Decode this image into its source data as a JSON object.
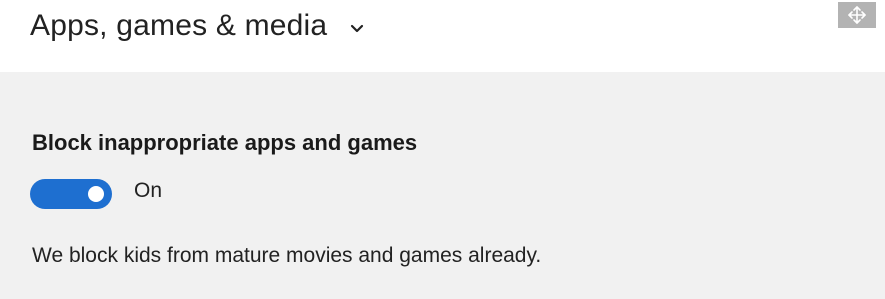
{
  "header": {
    "title": "Apps, games & media",
    "chevron_icon": "chevron-down-icon"
  },
  "corner_icon": "move-arrows-icon",
  "setting": {
    "title": "Block inappropriate apps and games",
    "toggle_state": "On",
    "toggle_on": true,
    "description": "We block kids from mature movies and games already."
  },
  "colors": {
    "accent": "#1e6fd0",
    "panel_background": "#f1f1f1",
    "header_background": "#ffffff"
  }
}
